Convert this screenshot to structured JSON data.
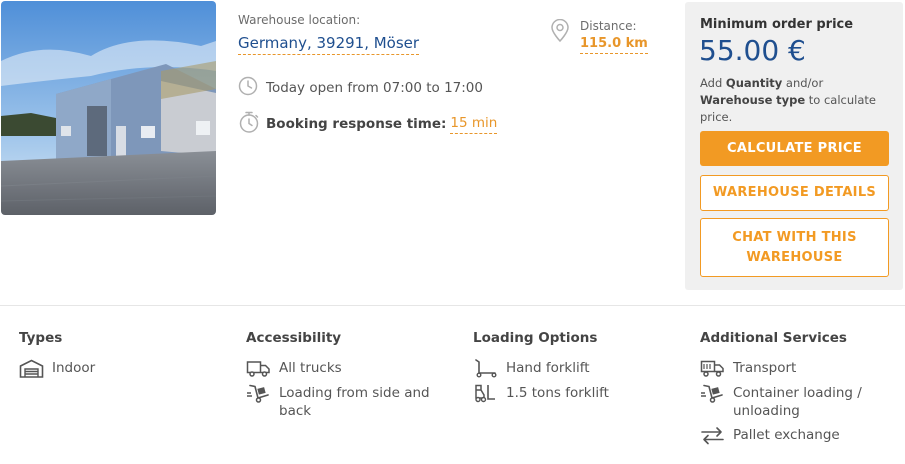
{
  "listing": {
    "photo_alt": "warehouse-photo",
    "location_label": "Warehouse location:",
    "location_value": "Germany, 39291, Möser",
    "hours_text": "Today open from 07:00 to 17:00",
    "booking_label": "Booking response time:",
    "booking_value": "15 min",
    "distance_label": "Distance:",
    "distance_value": "115.0 km"
  },
  "pricing": {
    "min_order_label": "Minimum order price",
    "min_order_value": "55.00 €",
    "hint_add": "Add",
    "hint_quantity": "Quantity",
    "hint_andor": "and/or",
    "hint_warehouse": "Warehouse",
    "hint_type": "type",
    "hint_rest": "to calculate price.",
    "calculate_label": "CALCULATE PRICE",
    "details_label": "WAREHOUSE DETAILS",
    "chat_line1": "CHAT WITH THIS",
    "chat_line2": "WAREHOUSE"
  },
  "features": {
    "types": {
      "title": "Types",
      "items": [
        "Indoor"
      ]
    },
    "accessibility": {
      "title": "Accessibility",
      "items": [
        "All trucks",
        "Loading from side and back"
      ]
    },
    "loading": {
      "title": "Loading Options",
      "items": [
        "Hand forklift",
        "1.5 tons forklift"
      ]
    },
    "additional": {
      "title": "Additional Services",
      "items": [
        "Transport",
        "Container loading / unloading",
        "Pallet exchange"
      ]
    }
  },
  "colors": {
    "accent": "#f29a23",
    "brand_blue": "#1f4f8f",
    "panel_bg": "#f0f0f0",
    "icon_gray": "#b0b0b0"
  },
  "icons": {
    "hours": "clock-icon",
    "booking": "stopwatch-icon",
    "distance": "map-pin-icon",
    "indoor": "warehouse-icon",
    "all_trucks": "truck-icon",
    "loading_side": "hand-truck-icon",
    "hand_forklift": "hand-forklift-icon",
    "tons_forklift": "forklift-icon",
    "transport": "transport-truck-icon",
    "container_loading": "container-loading-icon",
    "pallet_exchange": "exchange-arrows-icon"
  }
}
